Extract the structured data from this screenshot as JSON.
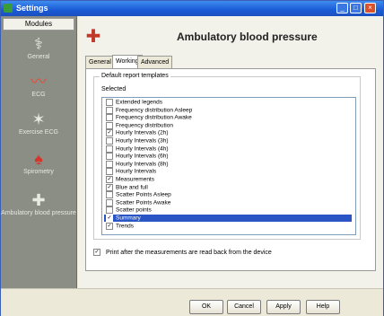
{
  "window": {
    "title": "Settings",
    "min_label": "_",
    "max_label": "□",
    "close_label": "×"
  },
  "sidebar": {
    "header": "Modules",
    "items": [
      {
        "label": "General",
        "icon": "stethoscope-icon"
      },
      {
        "label": "ECG",
        "icon": "ecg-icon"
      },
      {
        "label": "Exercise ECG",
        "icon": "exercise-icon"
      },
      {
        "label": "Spirometry",
        "icon": "lungs-icon"
      },
      {
        "label": "Ambulatory blood pressure",
        "icon": "blood-pressure-icon"
      }
    ]
  },
  "header": {
    "title": "Ambulatory blood pressure",
    "icon": "blood-pressure-icon"
  },
  "tabs": [
    "General",
    "Working",
    "Advanced"
  ],
  "active_tab": "Working",
  "group": {
    "legend": "Default report templates",
    "caption": "Selected",
    "items": [
      {
        "label": "Extended legends",
        "checked": false,
        "selected": false
      },
      {
        "label": "Frequency distribution Asleep",
        "checked": false,
        "selected": false
      },
      {
        "label": "Frequency distribution Awake",
        "checked": false,
        "selected": false
      },
      {
        "label": "Frequency distribution",
        "checked": false,
        "selected": false
      },
      {
        "label": "Hourly Intervals (2h)",
        "checked": true,
        "selected": false
      },
      {
        "label": "Hourly Intervals (3h)",
        "checked": false,
        "selected": false
      },
      {
        "label": "Hourly Intervals (4h)",
        "checked": false,
        "selected": false
      },
      {
        "label": "Hourly Intervals (6h)",
        "checked": false,
        "selected": false
      },
      {
        "label": "Hourly Intervals (8h)",
        "checked": false,
        "selected": false
      },
      {
        "label": "Hourly Intervals",
        "checked": false,
        "selected": false
      },
      {
        "label": "Measurements",
        "checked": true,
        "selected": false
      },
      {
        "label": "Blue and full",
        "checked": true,
        "selected": false
      },
      {
        "label": "Scatter Points Asleep",
        "checked": false,
        "selected": false
      },
      {
        "label": "Scatter Points Awake",
        "checked": false,
        "selected": false
      },
      {
        "label": "Scatter points",
        "checked": false,
        "selected": false
      },
      {
        "label": "Summary",
        "checked": true,
        "selected": true
      },
      {
        "label": "Trends",
        "checked": true,
        "selected": false
      }
    ]
  },
  "print_option": {
    "label": "Print after the measurements are read back from the device",
    "checked": true
  },
  "buttons": {
    "ok": "OK",
    "cancel": "Cancel",
    "apply": "Apply",
    "help": "Help"
  },
  "colors": {
    "titlebar": "#1a5bd6",
    "selection": "#2a55c5",
    "sidebar": "#8a8e84"
  }
}
